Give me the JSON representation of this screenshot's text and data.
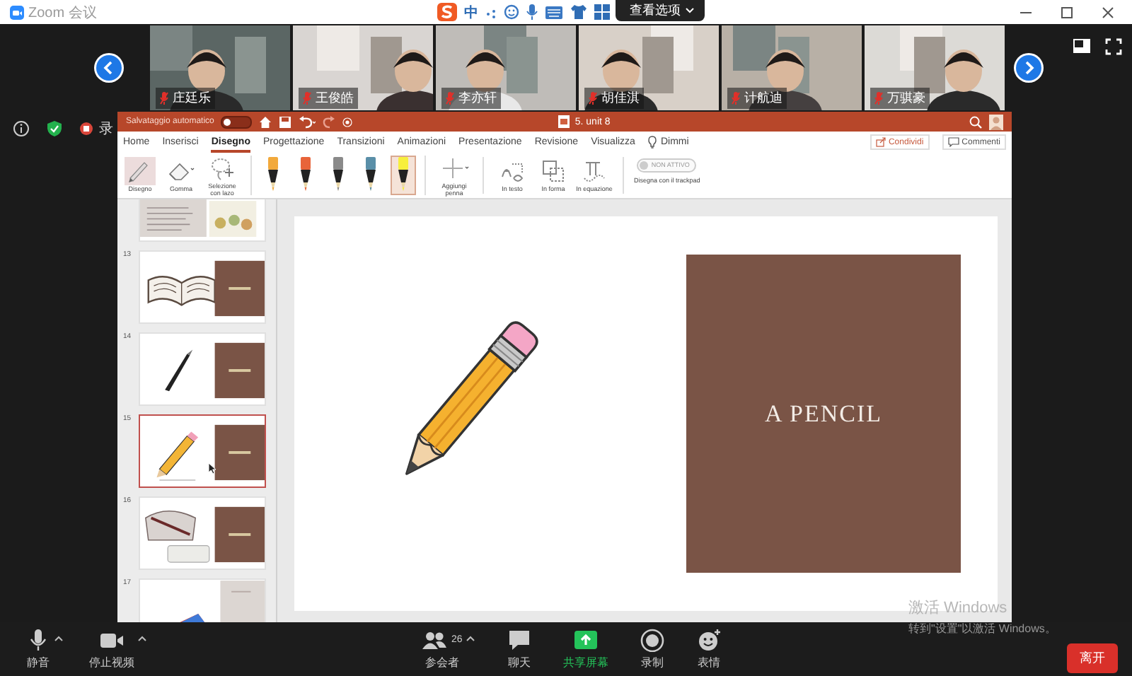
{
  "window": {
    "title": "Zoom 会议"
  },
  "ime_toolbar": {
    "mode": "中"
  },
  "view_options": {
    "label": "查看选项"
  },
  "participants_video": [
    {
      "name": "庄廷乐",
      "muted": true
    },
    {
      "name": "王俊皓",
      "muted": true
    },
    {
      "name": "李亦轩",
      "muted": true
    },
    {
      "name": "胡佳淇",
      "muted": true
    },
    {
      "name": "计航迪",
      "muted": true
    },
    {
      "name": "万骐豪",
      "muted": true
    }
  ],
  "meeting_indicators": {
    "recording_label": "录"
  },
  "powerpoint": {
    "autosave_label": "Salvataggio automatico",
    "autosave_on": false,
    "title": "5. unit 8",
    "tabs": [
      {
        "label": "Home",
        "selected": false
      },
      {
        "label": "Inserisci",
        "selected": false
      },
      {
        "label": "Disegno",
        "selected": true
      },
      {
        "label": "Progettazione",
        "selected": false
      },
      {
        "label": "Transizioni",
        "selected": false
      },
      {
        "label": "Animazioni",
        "selected": false
      },
      {
        "label": "Presentazione",
        "selected": false
      },
      {
        "label": "Revisione",
        "selected": false
      },
      {
        "label": "Visualizza",
        "selected": false
      }
    ],
    "tell_me": "Dimmi",
    "share": "Condividi",
    "comments": "Commenti",
    "tools": [
      {
        "label": "Disegno",
        "kind": "pen",
        "selected": true
      },
      {
        "label": "Gomma",
        "kind": "eraser",
        "selected": false
      },
      {
        "label": "Selezione con lazo",
        "kind": "lasso",
        "selected": false
      }
    ],
    "pens": [
      {
        "color": "#f2a93b",
        "selected": false
      },
      {
        "color": "#e8643a",
        "selected": false
      },
      {
        "color": "#8a8a8a",
        "selected": false
      },
      {
        "color": "#5a8fa8",
        "selected": false
      },
      {
        "color": "#f7ef3c",
        "selected": true
      }
    ],
    "add_pen": "Aggiungi penna",
    "convert": [
      {
        "label": "In testo",
        "kind": "text"
      },
      {
        "label": "In forma",
        "kind": "shape"
      },
      {
        "label": "In equazione",
        "kind": "equation"
      }
    ],
    "trackpad_toggle": {
      "state_label": "NON ATTIVO",
      "on": false
    },
    "trackpad_label": "Disegna con il trackpad",
    "slides": [
      {
        "kind": "text-pictures",
        "selected": false
      },
      {
        "number": "13",
        "kind": "book",
        "selected": false
      },
      {
        "number": "14",
        "kind": "pen",
        "selected": false
      },
      {
        "number": "15",
        "kind": "pencil",
        "selected": true
      },
      {
        "number": "16",
        "kind": "pencil-case",
        "selected": false
      },
      {
        "number": "17",
        "kind": "eraser",
        "selected": false
      }
    ],
    "slide": {
      "title": "A PENCIL"
    }
  },
  "toolbar": {
    "buttons": [
      {
        "label": "静音",
        "kind": "mic",
        "menu": true
      },
      {
        "label": "停止视频",
        "kind": "video",
        "menu": true
      },
      {
        "label": "参会者",
        "kind": "participants",
        "count": "26",
        "menu": true
      },
      {
        "label": "聊天",
        "kind": "chat",
        "menu": false
      },
      {
        "label": "共享屏幕",
        "kind": "share",
        "menu": false
      },
      {
        "label": "录制",
        "kind": "record",
        "menu": false
      },
      {
        "label": "表情",
        "kind": "reactions",
        "menu": false
      }
    ],
    "leave": "离开"
  },
  "os_notice": {
    "title": "激活 Windows",
    "detail": "转到\"设置\"以激活 Windows。"
  }
}
